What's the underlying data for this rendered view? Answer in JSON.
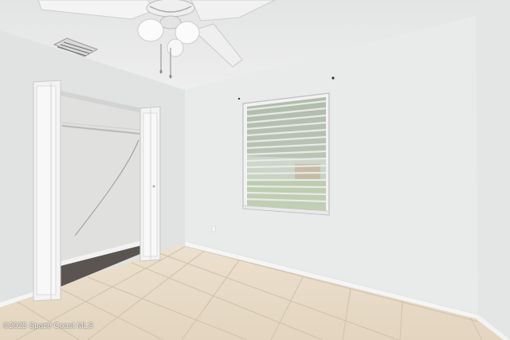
{
  "photo": {
    "subject": "Empty bedroom with tiled floor, open closet, window with blinds and ceiling fan",
    "watermark": "©2025 Space Coast MLS"
  },
  "colors": {
    "ceiling": "#e6e7e7",
    "left_wall": "#e2e3e3",
    "back_wall": "#e9eaea",
    "right_wall": "#e4e5e5",
    "floor_tile": "#e8dbc7",
    "grout": "#d2c2ab",
    "closet_floor": "#5c5650",
    "baseboard": "#f4f4f4"
  }
}
